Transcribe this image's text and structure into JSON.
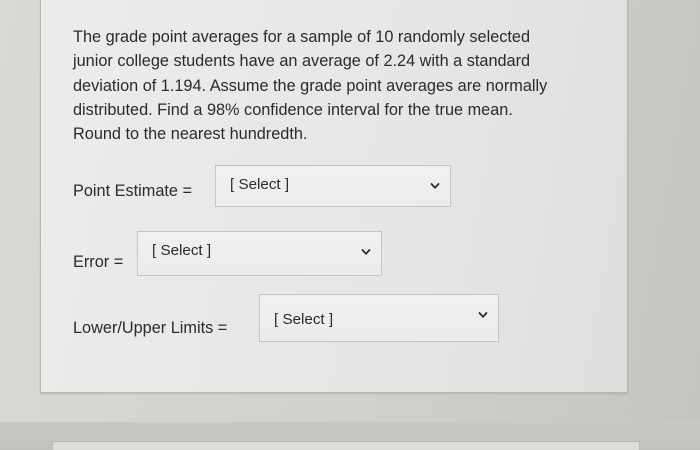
{
  "question": {
    "lines": [
      "The grade point averages for a sample of 10 randomly selected",
      "junior college students have an average of 2.24 with a standard",
      "deviation of 1.194. Assume the grade point averages are normally",
      "distributed. Find a 98% confidence interval for the true mean.",
      "Round to the nearest hundredth."
    ]
  },
  "answers": [
    {
      "label": "Point Estimate =",
      "selected": "[ Select ]"
    },
    {
      "label": "Error =",
      "selected": "[ Select ]"
    },
    {
      "label": "Lower/Upper Limits =",
      "selected": "[ Select ]"
    }
  ],
  "icons": {
    "dropdown": "chevron-down-icon"
  }
}
